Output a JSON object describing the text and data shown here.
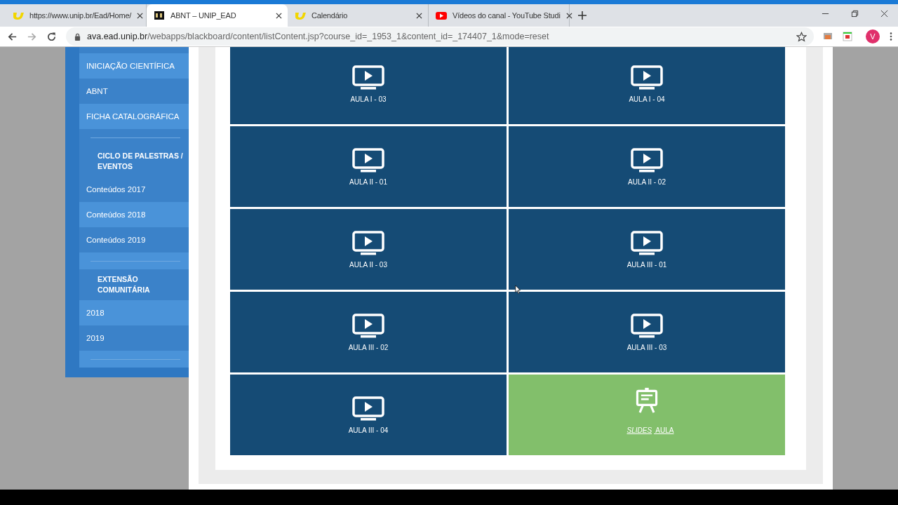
{
  "tabs": [
    {
      "title": "https://www.unip.br/Ead/Home/",
      "selected": false
    },
    {
      "title": "ABNT – UNIP_EAD",
      "selected": true
    },
    {
      "title": "Calendário",
      "selected": false
    },
    {
      "title": "Vídeos do canal - YouTube Studi",
      "selected": false
    }
  ],
  "address_bar": {
    "host": "ava.ead.unip.br",
    "path": "/webapps/blackboard/content/listContent.jsp?course_id=_1953_1&content_id=_174407_1&mode=reset"
  },
  "profile": {
    "initial": "V"
  },
  "sidebar": {
    "items": [
      {
        "kind": "stub"
      },
      {
        "kind": "link",
        "label": "INICIAÇÃO CIENTÍFICA"
      },
      {
        "kind": "link",
        "label": "ABNT"
      },
      {
        "kind": "link",
        "label": "FICHA CATALOGRÁFICA"
      },
      {
        "kind": "divider"
      },
      {
        "kind": "heading",
        "label": "CICLO DE PALESTRAS / EVENTOS"
      },
      {
        "kind": "link",
        "label": "Conteúdos 2017"
      },
      {
        "kind": "link",
        "label": "Conteúdos 2018"
      },
      {
        "kind": "link",
        "label": "Conteúdos 2019"
      },
      {
        "kind": "divider"
      },
      {
        "kind": "heading",
        "label": "EXTENSÃO COMUNITÁRIA"
      },
      {
        "kind": "link",
        "label": "2018"
      },
      {
        "kind": "link",
        "label": "2019"
      },
      {
        "kind": "divider"
      }
    ]
  },
  "tiles": [
    {
      "kind": "video",
      "label": "AULA I - 03"
    },
    {
      "kind": "video",
      "label": "AULA I - 04"
    },
    {
      "kind": "video",
      "label": "AULA II - 01"
    },
    {
      "kind": "video",
      "label": "AULA II - 02"
    },
    {
      "kind": "video",
      "label": "AULA II - 03"
    },
    {
      "kind": "video",
      "label": "AULA III - 01"
    },
    {
      "kind": "video",
      "label": "AULA III - 02"
    },
    {
      "kind": "video",
      "label": "AULA III - 03"
    },
    {
      "kind": "video",
      "label": "AULA III - 04"
    },
    {
      "kind": "slides",
      "label": "*SLIDES* AULA"
    }
  ]
}
